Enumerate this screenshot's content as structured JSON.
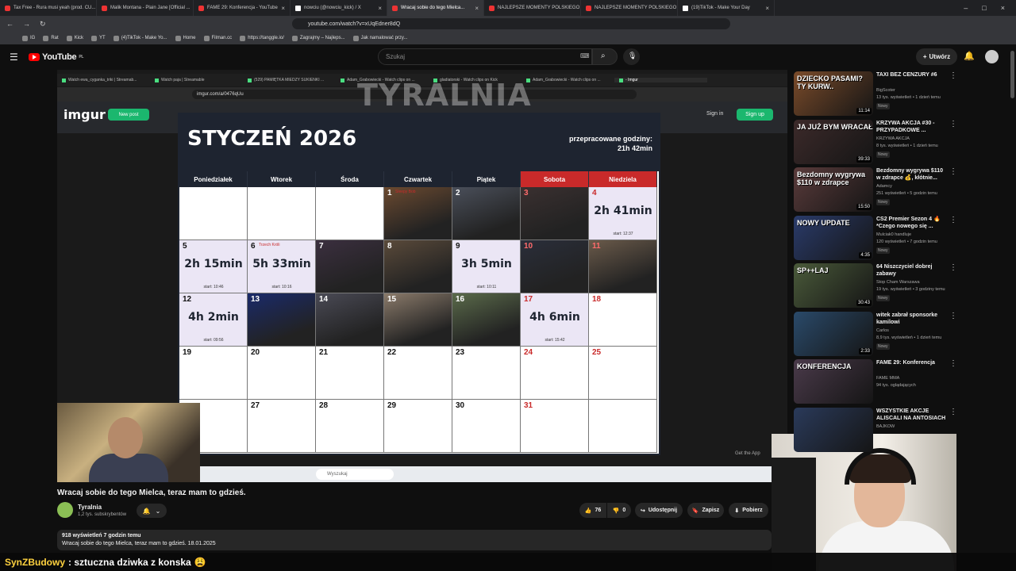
{
  "browser": {
    "tabs": [
      {
        "label": "Tax Free - Rura musi yeah (prod. CU...",
        "icon": "youtube-icon"
      },
      {
        "label": "Malik Montana - Plain Jane [Official ...",
        "icon": "youtube-icon"
      },
      {
        "label": "FAME 29: Konferencja - YouTube",
        "icon": "youtube-icon"
      },
      {
        "label": "nowciu (@nowciu_kick) / X",
        "icon": "x-icon"
      },
      {
        "label": "Wracaj sobie do tego Mielca...",
        "icon": "youtube-icon",
        "active": true
      },
      {
        "label": "NAJLEPSZE MOMENTY POLSKIEGO ...",
        "icon": "youtube-icon"
      },
      {
        "label": "NAJLEPSZE MOMENTY POLSKIEGO ...",
        "icon": "youtube-icon"
      },
      {
        "label": "(19)TikTok - Make Your Day",
        "icon": "tiktok-icon"
      }
    ],
    "url": "youtube.com/watch?v=xUqEdner8dQ",
    "bookmarks": [
      "IG",
      "Rat",
      "Kick",
      "YT",
      "(4)TikTok - Make Yo...",
      "Home",
      "Filman.cc",
      "https://tanggle.io/",
      "Zagrajmy – Najleps...",
      "Jak namalować przy..."
    ]
  },
  "youtube": {
    "logo": "YouTube",
    "logo_region": "PL",
    "search_placeholder": "Szukaj",
    "create_label": "Utwórz"
  },
  "stream": {
    "inner_tabs": [
      "Watch ewa_cyganka_triki | Streamab...",
      "Watch paja | Streamable",
      "(529) PAMIĘTKA MIEDZY SUKIENKI ...",
      "Adam_Grabowiecki - Watch clips on ...",
      "gladiatorski - Watch clips on Kick",
      "Adam_Grabowiecki - Watch clips on ...",
      "- Imgur"
    ],
    "inner_url": "imgur.com/a/0476qUu",
    "watermark": "TYRALNIA",
    "imgur_logo": "imgur",
    "new_post": "New post",
    "sign_in": "Sign in",
    "sign_up": "Sign up",
    "get_app": "Get the App",
    "taskbar_search": "Wyszukaj"
  },
  "calendar": {
    "title": "STYCZEŃ 2026",
    "hours_label": "przepracowane godziny:",
    "hours_value": "21h 42min",
    "days": [
      "Poniedziałek",
      "Wtorek",
      "Środa",
      "Czwartek",
      "Piątek",
      "Sobota",
      "Niedziela"
    ],
    "cells": [
      [
        {
          "num": ""
        },
        {
          "num": ""
        },
        {
          "num": ""
        },
        {
          "num": "1",
          "img": true,
          "note": "Sleepy Bob"
        },
        {
          "num": "2",
          "img": true
        },
        {
          "num": "3",
          "img": true
        },
        {
          "num": "4",
          "dur": "2h 41min",
          "start": "start: 12:37"
        }
      ],
      [
        {
          "num": "5",
          "dur": "2h 15min",
          "start": "start: 10:46"
        },
        {
          "num": "6",
          "dur": "5h 33min",
          "start": "start: 10:16",
          "note": "Trzech Króli"
        },
        {
          "num": "7",
          "img": true
        },
        {
          "num": "8",
          "img": true
        },
        {
          "num": "9",
          "dur": "3h 5min",
          "start": "start: 10:11"
        },
        {
          "num": "10",
          "img": true
        },
        {
          "num": "11",
          "img": true
        }
      ],
      [
        {
          "num": "12",
          "dur": "4h 2min",
          "start": "start: 09:56"
        },
        {
          "num": "13",
          "img": true
        },
        {
          "num": "14",
          "img": true
        },
        {
          "num": "15",
          "img": true
        },
        {
          "num": "16",
          "img": true
        },
        {
          "num": "17",
          "dur": "4h 6min",
          "start": "start: 15:42"
        },
        {
          "num": "18"
        }
      ],
      [
        {
          "num": "19"
        },
        {
          "num": "20"
        },
        {
          "num": "21"
        },
        {
          "num": "22"
        },
        {
          "num": "23"
        },
        {
          "num": "24"
        },
        {
          "num": "25"
        }
      ],
      [
        {
          "num": ""
        },
        {
          "num": "27"
        },
        {
          "num": "28"
        },
        {
          "num": "29"
        },
        {
          "num": "30"
        },
        {
          "num": "31"
        },
        {
          "num": ""
        }
      ]
    ]
  },
  "video": {
    "title": "Wracaj sobie do tego Mielca, teraz mam to gdzieś.",
    "channel": "Tyralnia",
    "subscribers": "1,2 tys. subskrybentów",
    "likes": "76",
    "dislikes": "0",
    "share": "Udostępnij",
    "save": "Zapisz",
    "download": "Pobierz",
    "views": "918 wyświetleń  7 godzin temu",
    "description": "Wracaj sobie do tego Mielca, teraz mam to gdzieś. 18.01.2025"
  },
  "chat": {
    "user": "SynZBudowy",
    "message": ": sztuczna dziwka z konska",
    "emoji": "😩"
  },
  "sidebar": [
    {
      "title": "TAXI BEZ CENZURY #6",
      "channel": "BigScoter",
      "meta": "13 tys. wyświetleń • 1 dzień temu",
      "badge": "Nowy",
      "duration": "11:14",
      "thumbtext": "DZIECKO PASAMI? TY KURW..",
      "color": "#7a4b2a"
    },
    {
      "title": "KRZYWA AKCJA #30 - PRZYPADKOWE ...",
      "channel": "KRZYWA AKCJA",
      "meta": "8 tys. wyświetleń • 1 dzień temu",
      "badge": "Nowy",
      "duration": "39:33",
      "thumbtext": "JA JUŻ BYM WRACAŁ",
      "color": "#3c2a2a"
    },
    {
      "title": "Bezdomny wygrywa $110 w zdrapce 💰, kłótnie...",
      "channel": "Adamcy",
      "meta": "251 wyświetleń • 5 godzin temu",
      "badge": "Nowy",
      "duration": "15:50",
      "thumbtext": "Bezdomny wygrywa $110 w zdrapce",
      "color": "#5a3b3b"
    },
    {
      "title": "CS2 Premier Sezon 4 🔥 *Czego nowego się ...",
      "channel": "Mulciak0 handluje",
      "meta": "120 wyświetleń • 7 godzin temu",
      "badge": "Nowy",
      "duration": "4:35",
      "thumbtext": "NOWY UPDATE",
      "color": "#2a3b6a"
    },
    {
      "title": "64 Niszczyciel dobrej zabawy",
      "channel": "Stop Cham Warszawa",
      "meta": "19 tys. wyświetleń • 3 godziny temu",
      "badge": "Nowy",
      "duration": "30:43",
      "thumbtext": "SP++LAJ",
      "color": "#4a5a3a"
    },
    {
      "title": "witek zabrał sponsorke kamilowi",
      "channel": "Carlos",
      "meta": "8,9 tys. wyświetleń • 1 dzień temu",
      "badge": "Nowy",
      "duration": "2:33",
      "thumbtext": "",
      "color": "#2a4a6a"
    },
    {
      "title": "FAME 29: Konferencja",
      "channel": "FAME MMA",
      "meta": "94 tys. oglądających",
      "badge": "",
      "duration": "",
      "thumbtext": "KONFERENCJA",
      "color": "#4a3a4a"
    },
    {
      "title": "WSZYSTKIE AKCJE ALISCALI NA ANTOSIACH",
      "channel": "BAJKOW",
      "meta": "",
      "badge": "",
      "duration": "",
      "thumbtext": "",
      "color": "#2a3a5a"
    }
  ]
}
